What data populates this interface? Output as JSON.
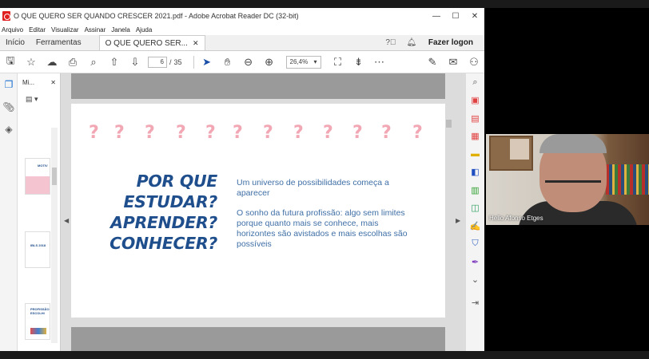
{
  "window": {
    "title": "O QUE QUERO SER QUANDO CRESCER 2021.pdf - Adobe Acrobat Reader DC (32-bit)",
    "controls": [
      "—",
      "☐",
      "✕"
    ]
  },
  "menu": [
    "Arquivo",
    "Editar",
    "Visualizar",
    "Assinar",
    "Janela",
    "Ajuda"
  ],
  "tabs": {
    "home": "Início",
    "tools": "Ferramentas",
    "document": "O QUE QUERO SER...",
    "login": "Fazer logon"
  },
  "toolbar": {
    "page_current": "6",
    "page_sep": "/",
    "page_total": "35",
    "zoom": "26,4%"
  },
  "thumbnails_panel": {
    "title": "Mi...",
    "pages": [
      {
        "caption": "MOTIV"
      },
      {
        "caption": "IBLS 2018"
      },
      {
        "caption": "PROFISSÃO ESCOLHI"
      }
    ]
  },
  "slide": {
    "question_marks": [
      "?",
      "?",
      "?",
      "?",
      "?",
      "?",
      "?",
      "?",
      "?",
      "?",
      "?",
      "?"
    ],
    "title_lines": [
      "POR QUE",
      "ESTUDAR?",
      "APRENDER?",
      "CONHECER?"
    ],
    "paragraph1": "Um universo de possibilidades começa a aparecer",
    "paragraph2": "O sonho da futura profissão: algo sem limites porque quanto mais se conhece, mais horizontes são avistados e mais escolhas são possíveis",
    "colors": {
      "title": "#1f4e8c",
      "body": "#3f6fa6",
      "question_marks": "#f2a8b4"
    }
  },
  "webcam": {
    "name": "Helio Afonso Etges"
  },
  "icons": {
    "toolbar": [
      "save-icon",
      "star-icon",
      "cloud-upload-icon",
      "print-icon",
      "zoom-search-icon",
      "page-up-icon",
      "page-down-icon",
      "cursor-icon",
      "hand-icon",
      "zoom-out-icon",
      "zoom-in-icon",
      "fit-page-icon",
      "scroll-mode-icon",
      "more-icon",
      "sign-icon",
      "email-icon",
      "add-user-icon"
    ],
    "right_panel": [
      "search-icon",
      "export-pdf-icon",
      "organize-icon",
      "create-pdf-icon",
      "comment-icon",
      "combine-icon",
      "compress-icon",
      "edit-icon",
      "fill-sign-icon",
      "protect-icon",
      "more-tools-icon",
      "collapse-icon"
    ]
  }
}
